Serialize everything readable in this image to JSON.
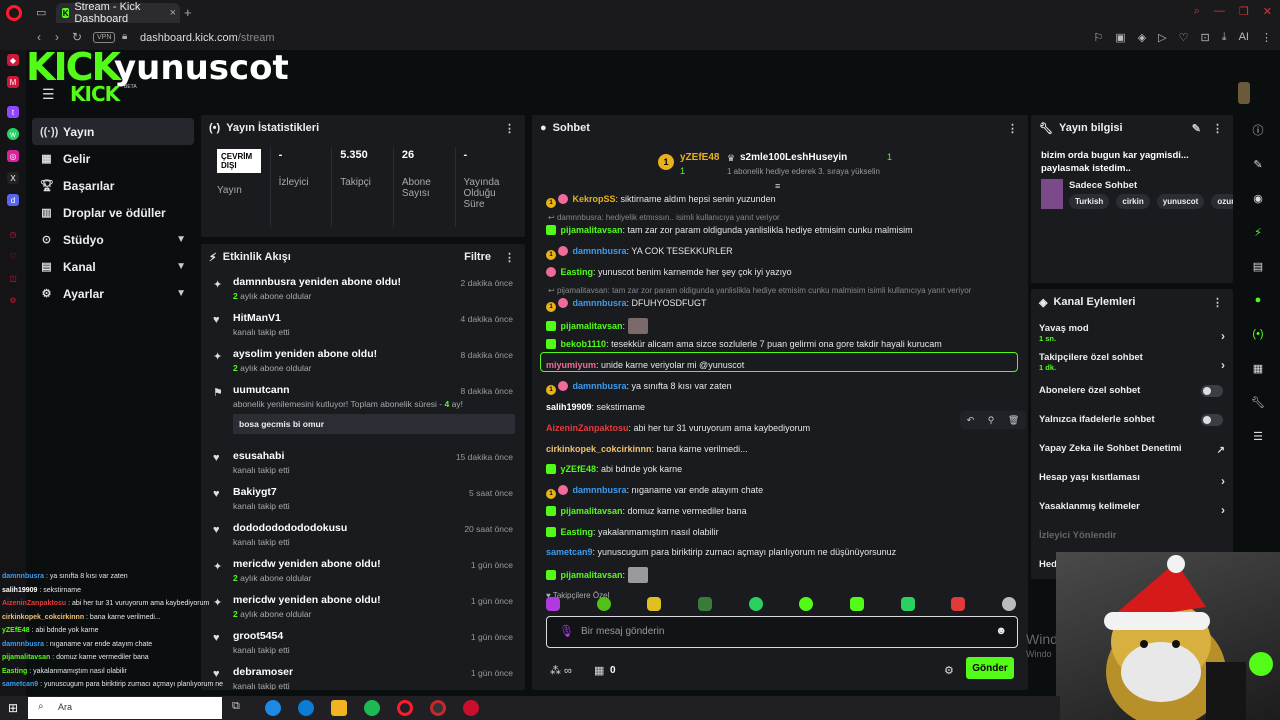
{
  "browser": {
    "tab_title": "Stream - Kick Dashboard",
    "url_host": "dashboard.kick.com",
    "url_path": "/stream",
    "vpn_label": "VPN",
    "ai_label": "AI"
  },
  "header": {
    "logo": "KICK",
    "logo_small": "KICK",
    "beta": "BETA",
    "streamer": "yunuscot"
  },
  "sidebar": {
    "items": [
      {
        "label": "Yayın",
        "icon": "broadcast-icon"
      },
      {
        "label": "Gelir",
        "icon": "revenue-icon"
      },
      {
        "label": "Başarılar",
        "icon": "trophy-icon"
      },
      {
        "label": "Droplar ve ödüller",
        "icon": "gift-icon"
      },
      {
        "label": "Stüdyo",
        "icon": "studio-icon"
      },
      {
        "label": "Kanal",
        "icon": "channel-icon"
      },
      {
        "label": "Ayarlar",
        "icon": "gear-icon"
      }
    ]
  },
  "stats": {
    "title": "Yayın İstatistikleri",
    "offline_badge": "ÇEVRİM DIŞI",
    "items": [
      {
        "value": "",
        "label": "Yayın"
      },
      {
        "value": "-",
        "label": "İzleyici"
      },
      {
        "value": "5.350",
        "label": "Takipçi"
      },
      {
        "value": "26",
        "label": "Abone Sayısı"
      },
      {
        "value": "-",
        "label": "Yayında Olduğu Süre"
      }
    ]
  },
  "activity": {
    "title": "Etkinlik Akışı",
    "filter": "Filtre",
    "items": [
      {
        "title": "damnnbusra yeniden abone oldu!",
        "sub_num": "2",
        "sub": " aylık abone oldular",
        "time": "2 dakika önce",
        "icon": "sparkle-icon"
      },
      {
        "title": "HitManV1",
        "sub": "kanalı takip etti",
        "time": "4 dakika önce",
        "icon": "heart-icon"
      },
      {
        "title": "aysolim yeniden abone oldu!",
        "sub_num": "2",
        "sub": " aylık abone oldular",
        "time": "8 dakika önce",
        "icon": "sparkle-icon"
      },
      {
        "title": "uumutcann",
        "sub": "abonelik yenilemesini kutluyor! Toplam abonelik süresi - ",
        "sub_num_after": "4",
        "sub_tail": " ay!",
        "message": "bosa gecmis bi omur",
        "time": "8 dakika önce",
        "icon": "party-icon"
      },
      {
        "title": "esusahabi",
        "sub": "kanalı takip etti",
        "time": "15 dakika önce",
        "icon": "heart-icon"
      },
      {
        "title": "Bakiygt7",
        "sub": "kanalı takip etti",
        "time": "5 saat önce",
        "icon": "heart-icon"
      },
      {
        "title": "dododododododokusu",
        "sub": "kanalı takip etti",
        "time": "20 saat önce",
        "icon": "heart-icon"
      },
      {
        "title": "mericdw yeniden abone oldu!",
        "sub_num": "2",
        "sub": " aylık abone oldular",
        "time": "1 gün önce",
        "icon": "sparkle-icon"
      },
      {
        "title": "mericdw yeniden abone oldu!",
        "sub_num": "2",
        "sub": " aylık abone oldular",
        "time": "1 gün önce",
        "icon": "sparkle-icon"
      },
      {
        "title": "groot5454",
        "sub": "kanalı takip etti",
        "time": "1 gün önce",
        "icon": "heart-icon"
      },
      {
        "title": "debramoser",
        "sub": "kanalı takip etti",
        "time": "1 gün önce",
        "icon": "heart-icon"
      }
    ]
  },
  "chat": {
    "title": "Sohbet",
    "leader_user": "yZEfE48",
    "leader_count": "1",
    "gifter_user": "s2mle100LeshHuseyin",
    "gifter_count": "1",
    "gifter_note": "1 abonelik hediye ederek 3. sıraya yükselin",
    "messages": [
      {
        "user": "KekropSS",
        "color": "#e8b21a",
        "badges": [
          "gold",
          "pink"
        ],
        "text": ": siktirname aldım hepsi senin yuzunden",
        "reply": ""
      },
      {
        "user": "pijamalitavsan",
        "color": "#53fc18",
        "badges": [
          "green"
        ],
        "text": ": tam zar zor param oldigunda yanlislikla hediye etmisim cunku malmisim",
        "reply": "damnnbusra: hediyelik etmıssın.. isimli kullanıcıya yanıt veriyor"
      },
      {
        "user": "damnnbusra",
        "color": "#3c9cf0",
        "badges": [
          "gold",
          "pink"
        ],
        "text": ": YA COK TESEKKURLER",
        "reply": ""
      },
      {
        "user": "Easting",
        "color": "#53fc18",
        "badges": [
          "pink"
        ],
        "text": ": yunuscot benim karnemde her şey çok iyi yazıyo",
        "reply": ""
      },
      {
        "user": "damnnbusra",
        "color": "#3c9cf0",
        "badges": [
          "gold",
          "pink"
        ],
        "text": ": DFUHYOSDFUGT",
        "reply": "pijamalitavsan: tam zar zor param oldigunda yanlislikla hediye etmisim cunku malmisim isimli kullanıcıya yanıt veriyor"
      },
      {
        "user": "pijamalitavsan",
        "color": "#53fc18",
        "badges": [
          "green"
        ],
        "text": ":",
        "reply": "",
        "emote": true
      },
      {
        "user": "bekob1110",
        "color": "#53fc18",
        "badges": [
          "green"
        ],
        "text": ": tesekkür alicam ama sizce sozlulerle 7 puan gelirmi ona gore takdir hayali kurucam",
        "reply": ""
      },
      {
        "user": "miyumiyum",
        "color": "#f06a9a",
        "badges": [],
        "text": ": unide karne veriyolar mi @yunuscot",
        "reply": ""
      },
      {
        "user": "damnnbusra",
        "color": "#3c9cf0",
        "badges": [
          "gold",
          "pink"
        ],
        "text": ": ya sınıfta 8 kısı var zaten",
        "reply": ""
      },
      {
        "user": "salih19909",
        "color": "#ffffff",
        "badges": [],
        "text": ": sekstirname",
        "reply": ""
      },
      {
        "user": "AizeninZanpaktosu",
        "color": "#e83a3a",
        "badges": [],
        "text": ": abi her tur 31 vuruyorum ama kaybediyorum",
        "reply": ""
      },
      {
        "user": "cirkinkopek_cokcirkinnn",
        "color": "#f0c070",
        "badges": [],
        "text": ": bana karne verilmedi...",
        "reply": ""
      },
      {
        "user": "yZEfE48",
        "color": "#53fc18",
        "badges": [
          "green"
        ],
        "text": ": abi bdnde yok karne",
        "reply": ""
      },
      {
        "user": "damnnbusra",
        "color": "#3c9cf0",
        "badges": [
          "gold",
          "pink"
        ],
        "text": ": nıganame var ende atayım chate",
        "reply": ""
      },
      {
        "user": "pijamalitavsan",
        "color": "#53fc18",
        "badges": [
          "green"
        ],
        "text": ": domuz karne vermediler bana",
        "reply": ""
      },
      {
        "user": "Easting",
        "color": "#53fc18",
        "badges": [
          "green"
        ],
        "text": ": yakalanmamıştım nasıl olabilir",
        "reply": ""
      },
      {
        "user": "sametcan9",
        "color": "#3c9cf0",
        "badges": [],
        "text": ": yunuscugum para biriktirip zurnacı açmayı planlıyorum ne düşünüyorsunuz",
        "reply": ""
      },
      {
        "user": "pijamalitavsan",
        "color": "#53fc18",
        "badges": [
          "green"
        ],
        "text": ":",
        "reply": "",
        "emote": true
      }
    ],
    "followers_only": "Takipçilere Özel",
    "input_placeholder": "Bir mesaj gönderin",
    "points": "0",
    "send": "Gönder"
  },
  "stream_info": {
    "title": "Yayın bilgisi",
    "stream_title": "bizim orda bugun kar yagmisdi... paylasmak istedim..",
    "category": "Sadece Sohbet",
    "tags": [
      "Turkish",
      "cirkin",
      "yunuscot",
      "ozur"
    ]
  },
  "channel_actions": {
    "title": "Kanal Eylemleri",
    "items": [
      {
        "label": "Yavaş mod",
        "sub": "1 sn.",
        "control": "arrow"
      },
      {
        "label": "Takipçilere özel sohbet",
        "sub": "1 dk.",
        "control": "arrow"
      },
      {
        "label": "Abonelere özel sohbet",
        "sub": "",
        "control": "toggle"
      },
      {
        "label": "Yalnızca ifadelerle sohbet",
        "sub": "",
        "control": "toggle"
      },
      {
        "label": "Yapay Zeka ile Sohbet Denetimi",
        "sub": "",
        "control": "external"
      },
      {
        "label": "Hesap yaşı kısıtlaması",
        "sub": "",
        "control": "arrow"
      },
      {
        "label": "Yasaklanmış kelimeler",
        "sub": "",
        "control": "arrow"
      },
      {
        "label": "İzleyici Yönlendir",
        "sub": "",
        "control": "none",
        "dim": true
      },
      {
        "label": "Hed",
        "sub": "",
        "control": "none"
      }
    ]
  },
  "overlay_chat": [
    {
      "user": "damnnbusra",
      "color": "#3c9cf0",
      "text": " : ya sınıfta 8 kısı var zaten"
    },
    {
      "user": "salih19909",
      "color": "#ffffff",
      "text": " : sekstirname"
    },
    {
      "user": "AizeninZanpaktosu",
      "color": "#e83a3a",
      "text": " : abi her tur 31 vuruyorum ama kaybediyorum"
    },
    {
      "user": "cirkinkopek_cokcirkinnn",
      "color": "#f0c070",
      "text": " : bana karne verilmedi..."
    },
    {
      "user": "yZEfE48",
      "color": "#53fc18",
      "text": " : abi bdnde yok karne"
    },
    {
      "user": "damnnbusra",
      "color": "#3c9cf0",
      "text": " : nıganame var ende atayım chate"
    },
    {
      "user": "pijamalitavsan",
      "color": "#53fc18",
      "text": " : domuz karne vermediler bana"
    },
    {
      "user": "Easting",
      "color": "#53fc18",
      "text": " : yakalanmamıştım nasıl olabilir"
    },
    {
      "user": "sametcan9",
      "color": "#3c9cf0",
      "text": " : yunuscugum para biriktirip zurnacı açmayı planlıyorum ne"
    }
  ],
  "taskbar": {
    "search": "Ara"
  },
  "watermark": {
    "line1": "Wind",
    "line2": "Windo"
  }
}
